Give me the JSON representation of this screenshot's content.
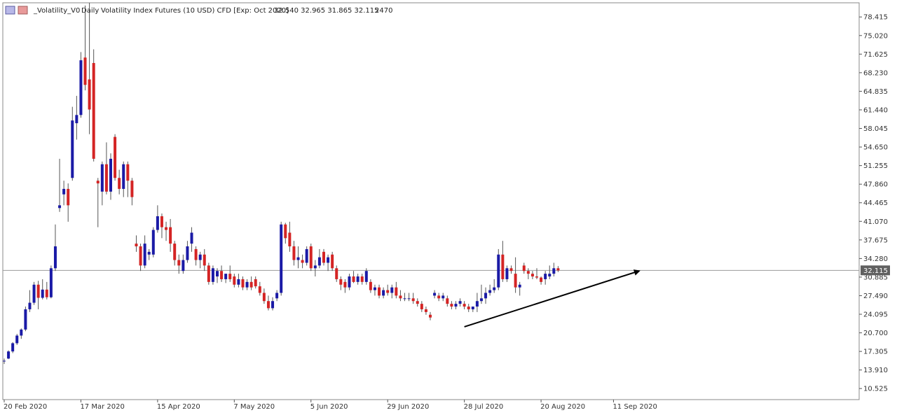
{
  "header": {
    "symbol": "_Volatility_V0",
    "timeframe": "Daily",
    "description": "Volatility Index Futures (10 USD) CFD [Exp: Oct 2020]",
    "ohlc": "32.540 32.965 31.865 32.115",
    "volume": "2470"
  },
  "current_price": {
    "value": 32.115,
    "label": "32.115"
  },
  "colors": {
    "bull": "#1a1aa6",
    "bear": "#d42424",
    "wick": "#555555",
    "grid_frame": "#888888",
    "price_line": "#9a9a9a",
    "price_badge": "#606060",
    "trendline": "#000000"
  },
  "chart_data": {
    "type": "candlestick",
    "ylim": [
      8.5,
      81.0
    ],
    "y_ticks": [
      "78.415",
      "75.020",
      "71.625",
      "68.230",
      "64.835",
      "61.440",
      "58.045",
      "54.650",
      "51.255",
      "47.860",
      "44.465",
      "41.070",
      "37.675",
      "34.280",
      "30.885",
      "27.490",
      "24.095",
      "20.700",
      "17.305",
      "13.910",
      "10.525"
    ],
    "x_labels": [
      {
        "label": "20 Feb 2020",
        "index": 0
      },
      {
        "label": "17 Mar 2020",
        "index": 18
      },
      {
        "label": "15 Apr 2020",
        "index": 36
      },
      {
        "label": "7 May 2020",
        "index": 54
      },
      {
        "label": "5 Jun 2020",
        "index": 72
      },
      {
        "label": "29 Jun 2020",
        "index": 90
      },
      {
        "label": "28 Jul 2020",
        "index": 108
      },
      {
        "label": "20 Aug 2020",
        "index": 126
      },
      {
        "label": "11 Sep 2020",
        "index": 143
      }
    ],
    "candles": [
      [
        15.5,
        16.0,
        15.0,
        15.6
      ],
      [
        16.0,
        17.5,
        15.9,
        17.3
      ],
      [
        17.3,
        19.0,
        17.0,
        18.8
      ],
      [
        18.8,
        20.5,
        18.5,
        20.2
      ],
      [
        20.2,
        21.5,
        19.6,
        21.3
      ],
      [
        21.3,
        25.5,
        21.0,
        25.0
      ],
      [
        25.0,
        28.5,
        24.5,
        26.2
      ],
      [
        26.2,
        30.0,
        25.8,
        29.5
      ],
      [
        29.5,
        30.2,
        25.0,
        27.1
      ],
      [
        27.1,
        30.5,
        26.8,
        28.6
      ],
      [
        28.6,
        30.0,
        26.8,
        27.2
      ],
      [
        27.2,
        33.0,
        27.0,
        32.5
      ],
      [
        32.5,
        40.5,
        32.0,
        36.5
      ],
      [
        43.5,
        52.5,
        42.8,
        44.0
      ],
      [
        46.0,
        48.5,
        44.0,
        47.0
      ],
      [
        47.0,
        48.0,
        41.0,
        44.0
      ],
      [
        49.0,
        62.0,
        48.5,
        59.5
      ],
      [
        59.0,
        64.0,
        56.0,
        60.5
      ],
      [
        60.5,
        72.0,
        60.0,
        70.5
      ],
      [
        71.0,
        80.5,
        65.0,
        66.0
      ],
      [
        67.0,
        81.0,
        57.0,
        61.5
      ],
      [
        70.0,
        72.5,
        52.0,
        52.5
      ],
      [
        48.5,
        49.0,
        40.0,
        48.0
      ],
      [
        46.5,
        52.0,
        44.0,
        51.5
      ],
      [
        51.5,
        55.5,
        46.0,
        46.5
      ],
      [
        46.5,
        53.5,
        45.0,
        52.5
      ],
      [
        56.5,
        57.0,
        48.5,
        49.0
      ],
      [
        49.0,
        50.5,
        46.0,
        47.0
      ],
      [
        47.0,
        52.0,
        45.5,
        51.5
      ],
      [
        51.5,
        52.0,
        45.5,
        48.5
      ],
      [
        48.5,
        49.0,
        44.0,
        45.5
      ],
      [
        37.0,
        38.5,
        35.5,
        36.5
      ],
      [
        36.5,
        37.0,
        32.0,
        33.0
      ],
      [
        33.0,
        38.5,
        32.5,
        37.0
      ],
      [
        35.0,
        36.0,
        34.0,
        35.5
      ],
      [
        35.0,
        40.0,
        34.5,
        39.5
      ],
      [
        39.5,
        44.0,
        39.0,
        42.0
      ],
      [
        42.0,
        42.5,
        38.0,
        40.0
      ],
      [
        40.0,
        41.0,
        37.5,
        39.5
      ],
      [
        40.0,
        41.5,
        35.5,
        37.0
      ],
      [
        37.0,
        37.5,
        33.0,
        34.0
      ],
      [
        34.0,
        35.0,
        31.5,
        33.0
      ],
      [
        32.0,
        35.0,
        31.5,
        34.0
      ],
      [
        34.0,
        37.5,
        33.5,
        36.5
      ],
      [
        37.0,
        40.0,
        35.5,
        39.0
      ],
      [
        36.0,
        36.5,
        33.0,
        34.0
      ],
      [
        34.0,
        35.5,
        32.5,
        35.0
      ],
      [
        35.0,
        36.0,
        32.0,
        33.0
      ],
      [
        33.0,
        33.5,
        29.5,
        30.0
      ],
      [
        30.0,
        33.0,
        29.5,
        32.5
      ],
      [
        31.0,
        32.5,
        29.8,
        32.0
      ],
      [
        32.0,
        33.0,
        30.0,
        30.5
      ],
      [
        30.5,
        31.5,
        29.8,
        31.5
      ],
      [
        31.5,
        33.0,
        30.0,
        30.5
      ],
      [
        31.0,
        31.5,
        29.0,
        29.5
      ],
      [
        29.5,
        31.5,
        29.0,
        30.5
      ],
      [
        30.5,
        31.0,
        28.5,
        29.0
      ],
      [
        29.0,
        30.5,
        28.5,
        30.0
      ],
      [
        30.0,
        31.0,
        28.5,
        29.0
      ],
      [
        30.5,
        31.0,
        28.8,
        29.2
      ],
      [
        29.2,
        30.0,
        27.5,
        28.0
      ],
      [
        28.0,
        28.8,
        26.0,
        26.5
      ],
      [
        26.5,
        27.5,
        24.8,
        25.2
      ],
      [
        25.2,
        27.2,
        24.8,
        26.5
      ],
      [
        27.0,
        28.5,
        26.5,
        28.0
      ],
      [
        28.0,
        41.0,
        27.5,
        40.5
      ],
      [
        40.5,
        40.8,
        37.0,
        38.0
      ],
      [
        39.0,
        41.0,
        35.5,
        36.5
      ],
      [
        36.5,
        37.5,
        33.0,
        34.0
      ],
      [
        34.0,
        36.5,
        32.5,
        34.5
      ],
      [
        34.0,
        35.0,
        32.5,
        33.5
      ],
      [
        33.5,
        36.5,
        33.0,
        36.0
      ],
      [
        36.5,
        37.0,
        32.0,
        32.5
      ],
      [
        32.5,
        34.0,
        31.0,
        33.0
      ],
      [
        33.0,
        36.0,
        32.5,
        34.5
      ],
      [
        35.5,
        36.0,
        33.0,
        33.5
      ],
      [
        33.5,
        35.0,
        32.0,
        34.5
      ],
      [
        35.0,
        35.5,
        32.0,
        32.5
      ],
      [
        32.5,
        33.0,
        30.0,
        30.5
      ],
      [
        30.5,
        31.0,
        28.5,
        29.5
      ],
      [
        30.0,
        30.5,
        28.0,
        29.0
      ],
      [
        29.0,
        31.5,
        28.5,
        31.0
      ],
      [
        31.0,
        32.0,
        29.8,
        30.0
      ],
      [
        30.0,
        31.5,
        29.5,
        31.0
      ],
      [
        31.0,
        31.5,
        29.5,
        30.0
      ],
      [
        30.0,
        32.5,
        29.5,
        32.0
      ],
      [
        30.0,
        30.5,
        28.0,
        28.5
      ],
      [
        28.5,
        29.5,
        27.5,
        29.0
      ],
      [
        29.0,
        29.5,
        27.0,
        27.5
      ],
      [
        27.5,
        29.0,
        27.0,
        28.5
      ],
      [
        28.5,
        29.5,
        27.5,
        28.0
      ],
      [
        28.0,
        29.5,
        27.0,
        29.0
      ],
      [
        29.0,
        30.0,
        27.0,
        27.5
      ],
      [
        27.5,
        28.5,
        26.5,
        27.0
      ],
      [
        27.0,
        28.0,
        26.5,
        27.0
      ],
      [
        27.0,
        28.0,
        26.5,
        27.0
      ],
      [
        27.0,
        28.0,
        26.0,
        26.5
      ],
      [
        26.5,
        27.0,
        25.5,
        26.0
      ],
      [
        26.0,
        26.5,
        24.5,
        25.0
      ],
      [
        25.0,
        25.5,
        24.0,
        24.5
      ],
      [
        24.0,
        24.5,
        23.0,
        23.5
      ],
      [
        27.5,
        28.5,
        27.0,
        28.0
      ],
      [
        27.5,
        28.0,
        26.5,
        27.0
      ],
      [
        27.0,
        28.0,
        26.5,
        27.5
      ],
      [
        27.0,
        27.5,
        25.5,
        26.0
      ],
      [
        26.0,
        26.5,
        25.0,
        25.5
      ],
      [
        25.5,
        26.5,
        25.0,
        26.0
      ],
      [
        26.0,
        27.0,
        25.5,
        26.5
      ],
      [
        26.0,
        26.5,
        25.0,
        25.5
      ],
      [
        25.5,
        26.0,
        24.5,
        25.0
      ],
      [
        25.0,
        25.5,
        24.5,
        25.5
      ],
      [
        25.5,
        28.0,
        24.5,
        26.5
      ],
      [
        26.5,
        29.5,
        26.0,
        27.0
      ],
      [
        27.0,
        29.0,
        26.0,
        28.0
      ],
      [
        28.0,
        29.5,
        27.5,
        28.5
      ],
      [
        28.5,
        30.5,
        28.0,
        29.0
      ],
      [
        29.0,
        36.0,
        28.5,
        35.0
      ],
      [
        35.0,
        37.5,
        30.0,
        30.5
      ],
      [
        30.5,
        33.0,
        30.0,
        32.5
      ],
      [
        32.5,
        33.0,
        31.5,
        32.0
      ],
      [
        31.5,
        34.5,
        28.0,
        29.0
      ],
      [
        29.0,
        30.0,
        27.5,
        29.5
      ],
      [
        33.0,
        33.5,
        31.5,
        32.0
      ],
      [
        32.0,
        32.5,
        30.5,
        31.5
      ],
      [
        31.5,
        32.0,
        30.5,
        31.0
      ],
      [
        31.0,
        32.5,
        30.5,
        30.8
      ],
      [
        30.8,
        31.0,
        29.5,
        30.0
      ],
      [
        30.5,
        32.0,
        29.5,
        31.5
      ],
      [
        31.0,
        33.0,
        30.5,
        31.5
      ],
      [
        31.5,
        33.5,
        31.0,
        32.5
      ],
      [
        32.5,
        32.9,
        31.8,
        32.1
      ]
    ],
    "trendline": {
      "from": {
        "index": 108,
        "value": 21.8
      },
      "to": {
        "index": 149,
        "value": 32.0
      }
    }
  }
}
